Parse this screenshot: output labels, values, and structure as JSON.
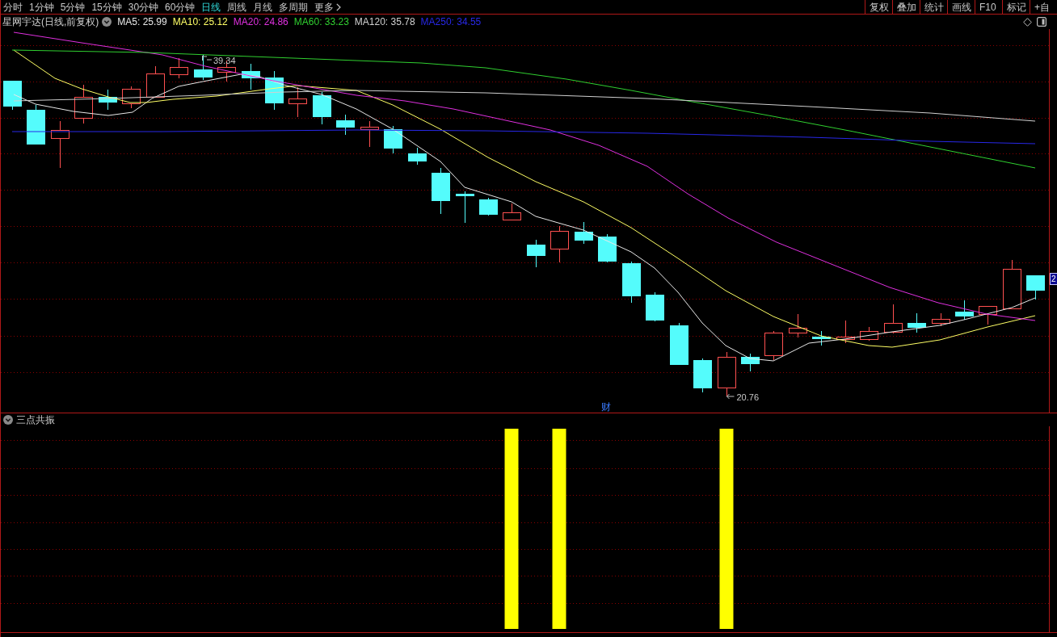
{
  "toolbar": {
    "periods": [
      {
        "label": "分时",
        "selected": false
      },
      {
        "label": "1分钟",
        "selected": false
      },
      {
        "label": "5分钟",
        "selected": false
      },
      {
        "label": "15分钟",
        "selected": false
      },
      {
        "label": "30分钟",
        "selected": false
      },
      {
        "label": "60分钟",
        "selected": false
      },
      {
        "label": "日线",
        "selected": true
      },
      {
        "label": "周线",
        "selected": false
      },
      {
        "label": "月线",
        "selected": false
      },
      {
        "label": "多周期",
        "selected": false
      }
    ],
    "more": "更多",
    "actions": [
      "复权",
      "叠加",
      "统计",
      "画线",
      "F10",
      "标记",
      "+自"
    ]
  },
  "main_chart": {
    "title": "星网宇达(日线,前复权)",
    "moving_averages": [
      {
        "label": "MA5: 25.99",
        "color": "#e8e8e8"
      },
      {
        "label": "MA10: 25.12",
        "color": "#ffff66"
      },
      {
        "label": "MA20: 24.86",
        "color": "#e030e0"
      },
      {
        "label": "MA60: 33.23",
        "color": "#30d030"
      },
      {
        "label": "MA120: 35.78",
        "color": "#d0d0d0"
      },
      {
        "label": "MA250: 34.55",
        "color": "#2828e8"
      }
    ],
    "high_label": "39.34",
    "low_label": "20.76",
    "event_marker": "财",
    "price_tag": "2"
  },
  "indicator_panel": {
    "title": "三点共振"
  }
}
